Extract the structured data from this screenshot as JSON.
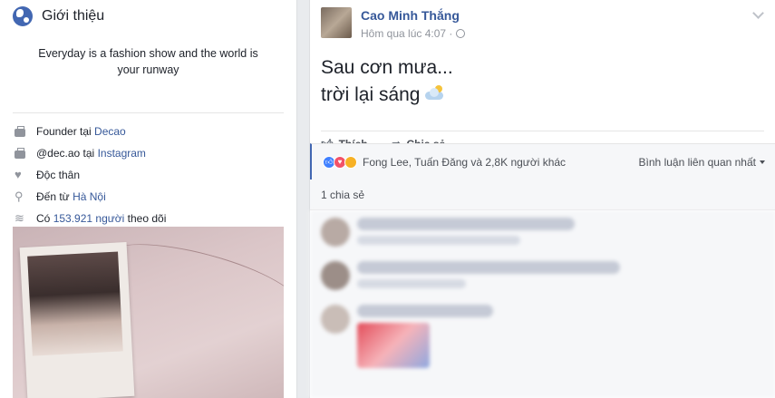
{
  "intro": {
    "title": "Giới thiệu",
    "bio": "Everyday is a fashion show and the world is your runway",
    "items": [
      {
        "prefix": "Founder tại ",
        "link": "Decao",
        "suffix": "",
        "icon": "briefcase-icon"
      },
      {
        "prefix": "@dec.ao tại ",
        "link": "Instagram",
        "suffix": "",
        "icon": "briefcase-icon"
      },
      {
        "prefix": "Độc thân",
        "link": "",
        "suffix": "",
        "icon": "heart-icon"
      },
      {
        "prefix": "Đến từ ",
        "link": "Hà Nội",
        "suffix": "",
        "icon": "location-pin-icon"
      },
      {
        "prefix": "Có ",
        "link": "153.921 người",
        "suffix": " theo dõi",
        "icon": "followers-icon"
      }
    ]
  },
  "post": {
    "author": "Cao Minh Thắng",
    "time": "Hôm qua lúc 4:07 ·",
    "text_line1": "Sau cơn mưa...",
    "text_line2": "trời lại sáng",
    "actions": {
      "like": "Thích",
      "share": "Chia sẻ"
    },
    "reactions_text": "Fong Lee, Tuấn Đăng và 2,8K người khác",
    "sort_label": "Bình luận liên quan nhất",
    "shares_text": "1 chia sẻ"
  },
  "colors": {
    "link": "#365899",
    "accent": "#4267b2",
    "background": "#e9ebee"
  }
}
